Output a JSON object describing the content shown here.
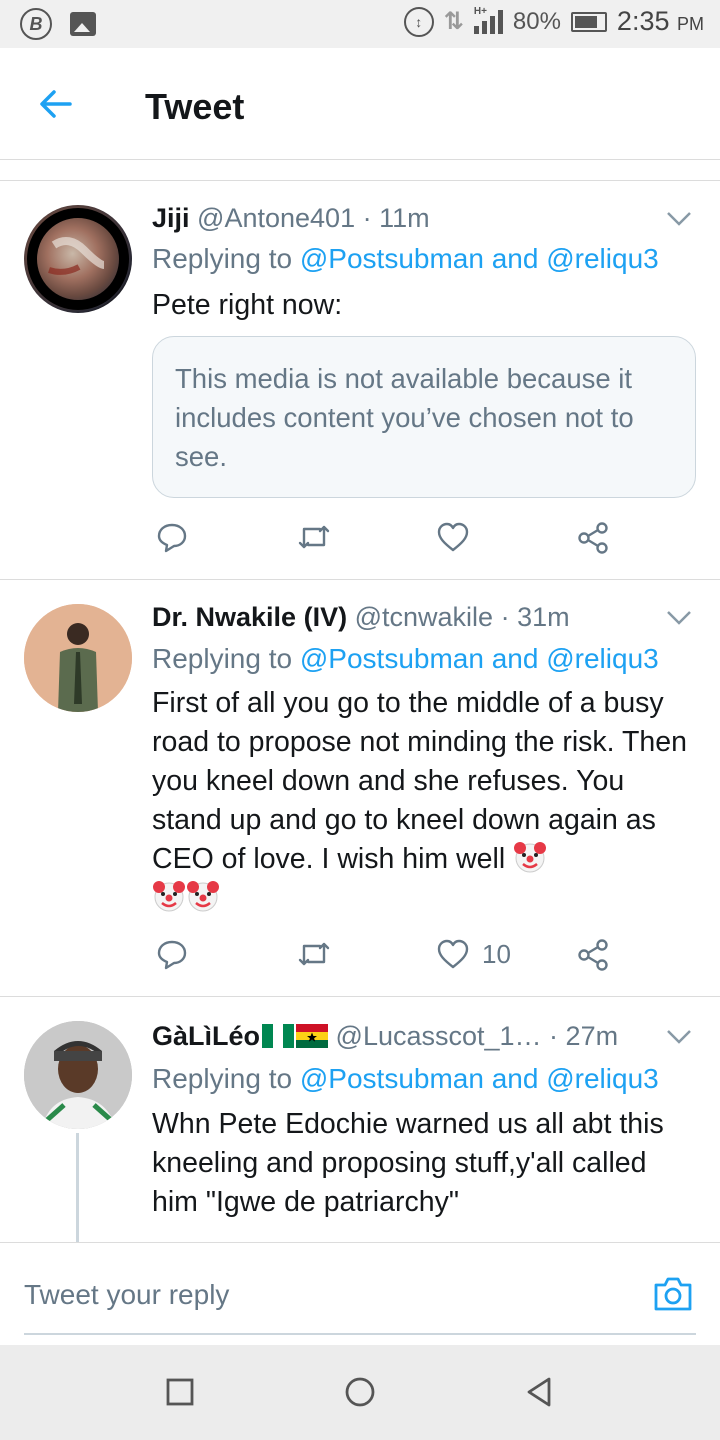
{
  "status_bar": {
    "left_icons": [
      "b-app-icon",
      "image-icon"
    ],
    "data_icon_label": "H+",
    "battery": "80%",
    "time": "2:35",
    "ampm": "PM"
  },
  "header": {
    "title": "Tweet"
  },
  "tweets": [
    {
      "name": "Jiji",
      "handle": "@Antone401",
      "sep": " · ",
      "time": "11m",
      "replying_prefix": "Replying to ",
      "mention1": "@Postsubman",
      "and": " and ",
      "mention2": "@reliqu3",
      "text": "Pete right now:",
      "media_notice": "This media is not available because it includes content you’ve chosen not to see.",
      "likes": ""
    },
    {
      "name": "Dr. Nwakile (IV)",
      "handle": "@tcnwakile",
      "sep": " · ",
      "time": "31m",
      "replying_prefix": "Replying to ",
      "mention1": "@Postsubman",
      "and": " and ",
      "mention2": "@reliqu3",
      "text": "First of all you go to the middle of a busy road to propose not minding the risk. Then you kneel down and she refuses. You stand up and go to kneel down again as CEO of love. I wish him well ",
      "likes": "10"
    },
    {
      "name": "GàLìLéo",
      "handle": "@Lucasscot_1…",
      "sep": " · ",
      "time": "27m",
      "replying_prefix": "Replying to ",
      "mention1": "@Postsubman",
      "and": " and ",
      "mention2": "@reliqu3",
      "text": "Whn Pete Edochie warned us all abt this kneeling and proposing stuff,y'all called him \"Igwe de patriarchy\""
    }
  ],
  "reply_bar": {
    "placeholder": "Tweet your reply"
  },
  "colors": {
    "accent": "#1da1f2",
    "secondary_text": "#657786",
    "primary_text": "#14171a",
    "divider": "#dcdcdc"
  }
}
